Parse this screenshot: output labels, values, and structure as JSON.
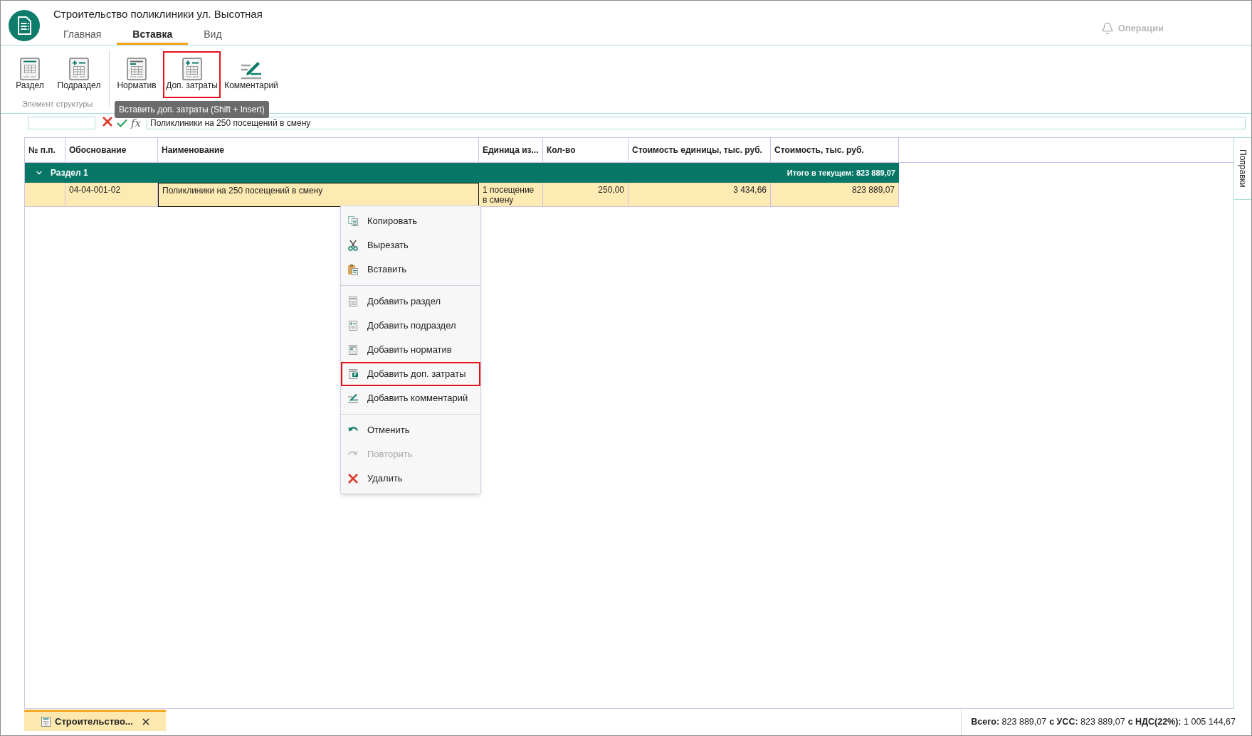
{
  "app": {
    "title": "Строительство поликлиники ул. Высотная"
  },
  "tabs": [
    {
      "label": "Главная",
      "selected": false
    },
    {
      "label": "Вставка",
      "selected": true
    },
    {
      "label": "Вид",
      "selected": false
    }
  ],
  "operations": {
    "label": "Операции",
    "disabled": true
  },
  "ribbon": {
    "groups": [
      {
        "label": "Элемент структуры",
        "buttons": [
          {
            "label": "Раздел",
            "highlighted": false
          },
          {
            "label": "Подраздел",
            "highlighted": false
          }
        ]
      },
      {
        "buttons": [
          {
            "label": "Норматив",
            "highlighted": false
          },
          {
            "label": "Доп. затраты",
            "highlighted": true
          },
          {
            "label": "Комментарий",
            "highlighted": false
          }
        ]
      }
    ]
  },
  "tooltip": "Вставить доп. затраты (Shift + Insert)",
  "formula_bar": {
    "function_button": "fx",
    "value": "Поликлиники на 250 посещений в смену"
  },
  "table": {
    "columns": [
      "№ п.п.",
      "Обоснование",
      "Наименование",
      "Единица из...",
      "Кол-во",
      "Стоимость единицы, тыс. руб.",
      "Стоимость, тыс. руб."
    ],
    "rows": [
      {
        "kind": "section",
        "label": "Раздел 1",
        "expanded": true,
        "total": "Итого в текущем: 823 889,07"
      },
      {
        "kind": "item",
        "selected": true,
        "cells": [
          {
            "focused": false
          },
          {
            "text": "04-04-001-02",
            "focused": false
          },
          {
            "text": "Поликлиники на 250 посещений в смену",
            "focused": true
          },
          {
            "text": "1 посещение в смену",
            "focused": false
          },
          {
            "text": "250,00",
            "focused": false
          },
          {
            "text": "3 434,66",
            "focused": false
          },
          {
            "text": "823 889,07",
            "focused": false
          }
        ]
      }
    ]
  },
  "context_menu": {
    "groups": [
      {
        "items": [
          {
            "label": "Копировать",
            "disabled": false,
            "highlighted": false
          },
          {
            "label": "Вырезать",
            "disabled": false,
            "highlighted": false
          },
          {
            "label": "Вставить",
            "disabled": false,
            "highlighted": false
          }
        ]
      },
      {
        "items": [
          {
            "label": "Добавить раздел",
            "disabled": false,
            "highlighted": false
          },
          {
            "label": "Добавить подраздел",
            "disabled": false,
            "highlighted": false
          },
          {
            "label": "Добавить норматив",
            "disabled": false,
            "highlighted": false
          },
          {
            "label": "Добавить доп. затраты",
            "disabled": false,
            "highlighted": true
          },
          {
            "label": "Добавить комментарий",
            "disabled": false,
            "highlighted": false
          }
        ]
      },
      {
        "items": [
          {
            "label": "Отменить",
            "disabled": false,
            "highlighted": false
          },
          {
            "label": "Повторить",
            "disabled": true,
            "highlighted": false
          },
          {
            "label": "Удалить",
            "disabled": false,
            "highlighted": false
          }
        ]
      }
    ]
  },
  "side_panel": {
    "tabs": [
      {
        "label": "Поправки"
      }
    ]
  },
  "document_tabs": [
    {
      "label": "Строительство...",
      "selected": true
    }
  ],
  "status_bar": {
    "totals": [
      "**Всего:** 823 889,07",
      "**с УСС:** 823 889,07",
      "**с НДС(22%):** 1 005 144,67"
    ]
  }
}
